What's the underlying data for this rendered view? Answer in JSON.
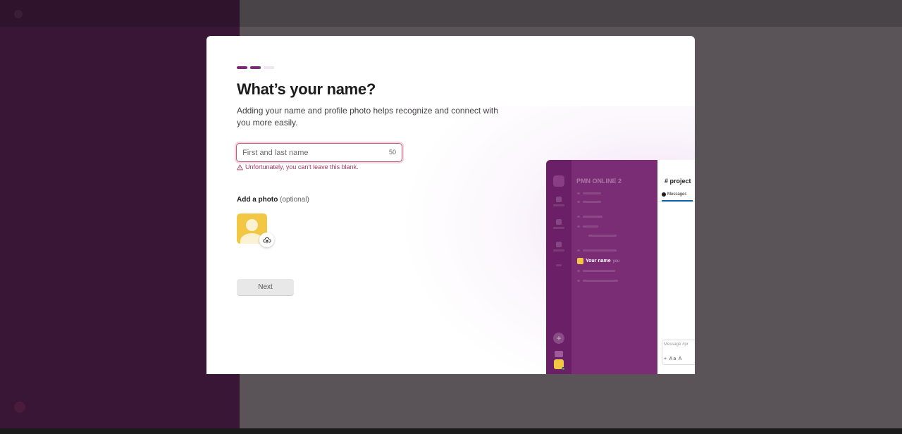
{
  "modal": {
    "title": "What’s your name?",
    "subtitle": "Adding your name and profile photo helps recognize and connect with you more easily.",
    "progress": {
      "completed_steps": 2,
      "total_steps": 3
    },
    "name_field": {
      "placeholder": "First and last name",
      "value": "",
      "char_count": "50"
    },
    "error_message": "Unfortunately, you can't leave this blank.",
    "photo": {
      "label": "Add a photo",
      "optional": "(optional)"
    },
    "next_button": "Next"
  },
  "preview": {
    "workspace_name": "PMN ONLINE 2",
    "user_name": "Your name",
    "user_suffix": "you",
    "channel": "# project",
    "tab": "Messages",
    "composer_placeholder": "Message #pr",
    "composer_tools": "+ Aa A"
  },
  "colors": {
    "accent": "#7a2a78",
    "error": "#a3385e",
    "avatar": "#f2c744",
    "sidebar": "#7a2c74"
  }
}
